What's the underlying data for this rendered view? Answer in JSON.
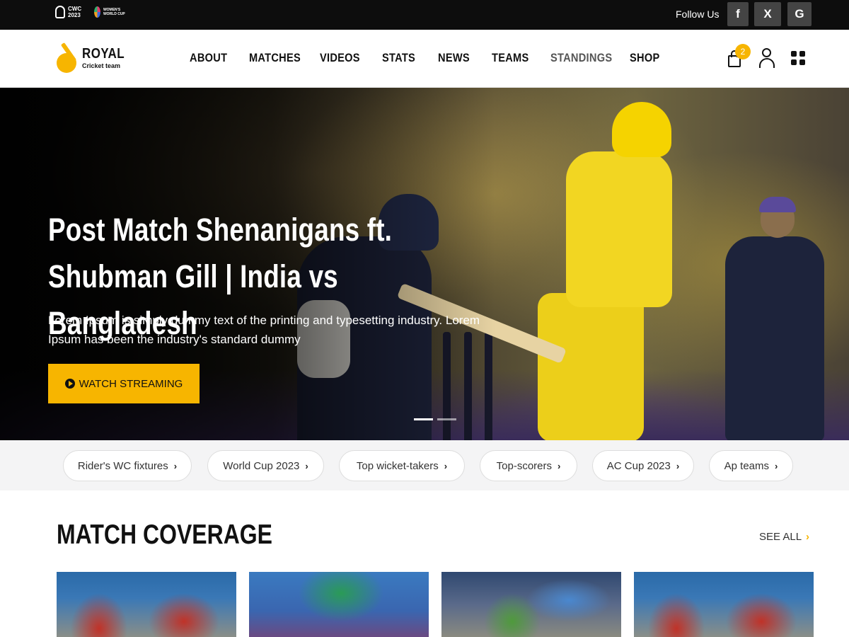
{
  "topbar": {
    "cwc_label_1": "CWC",
    "cwc_label_2": "2023",
    "wwc_label": "WOMEN'S WORLD CUP",
    "follow_label": "Follow Us",
    "social": [
      {
        "name": "facebook-icon",
        "glyph": "f"
      },
      {
        "name": "x-icon",
        "glyph": "X"
      },
      {
        "name": "google-icon",
        "glyph": "G"
      }
    ]
  },
  "header": {
    "brand_name": "ROYAL",
    "brand_sub": "Cricket team",
    "nav": [
      "ABOUT",
      "MATCHES",
      "VIDEOS",
      "STATS",
      "NEWS",
      "TEAMS",
      "STANDINGS",
      "SHOP"
    ],
    "cart_count": "2",
    "colors": {
      "accent": "#f7b500",
      "topbar": "#0d0d0d",
      "text": "#111111"
    }
  },
  "hero": {
    "title_line1": "Post Match Shenanigans ft.",
    "title_line2": "Shubman Gill | India vs Bangladesh",
    "description": "Lorem Ipsum is simply dummy text of the printing and typesetting industry. Lorem Ipsum has been the industry's standard dummy",
    "button_label": "WATCH STREAMING",
    "slides_total": 2,
    "active_slide": 1
  },
  "chips": [
    "Rider's WC fixtures",
    "World Cup 2023",
    "Top wicket-takers",
    "Top-scorers",
    "AC Cup 2023",
    "Ap teams"
  ],
  "coverage": {
    "title": "MATCH COVERAGE",
    "see_all": "SEE ALL",
    "cards": 4
  }
}
